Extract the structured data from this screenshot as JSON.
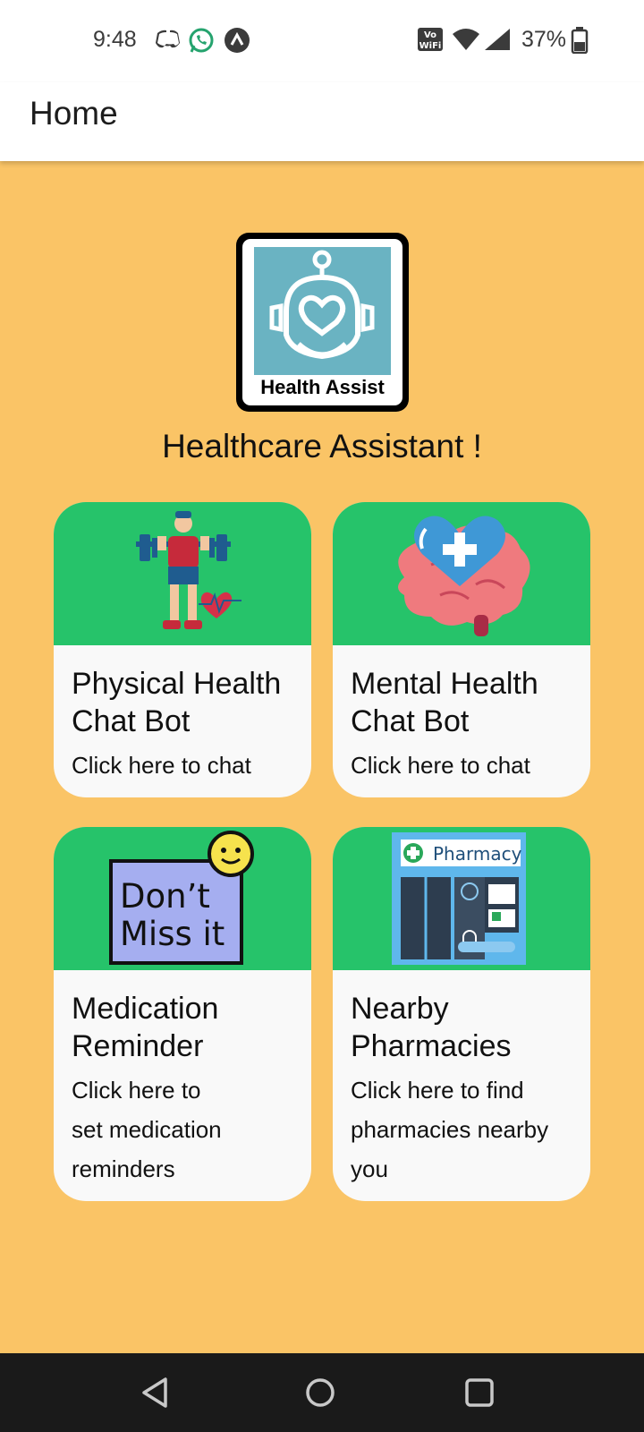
{
  "status_bar": {
    "time": "9:48",
    "battery": "37%",
    "icons": [
      "discord-icon",
      "whatsapp-icon",
      "arrow-up-circle-icon",
      "vowifi-icon",
      "wifi-icon",
      "signal-icon",
      "battery-icon"
    ]
  },
  "app_bar": {
    "title": "Home"
  },
  "logo": {
    "text": "Health Assist"
  },
  "headline": "Healthcare Assistant !",
  "cards": [
    {
      "title": "Physical Health\nChat Bot",
      "subtitle": "Click here to chat",
      "icon": "weightlifter-heart-icon"
    },
    {
      "title": "Mental Health\nChat Bot",
      "subtitle": "Click here to chat",
      "icon": "brain-heart-icon"
    },
    {
      "title": "Medication\nReminder",
      "subtitle": "Click here to\nset medication\nreminders",
      "icon": "dont-miss-it-icon",
      "icon_text": "Don't Miss it"
    },
    {
      "title": "Nearby\nPharmacies",
      "subtitle": "Click here to find\npharmacies nearby\nyou",
      "icon": "pharmacy-store-icon",
      "icon_text": "Pharmacy"
    }
  ],
  "nav_bar": {
    "buttons": [
      "back-icon",
      "home-icon",
      "recents-icon"
    ]
  },
  "colors": {
    "background": "#fac466",
    "card_header": "#26c36a",
    "card_body": "#f9f9f9"
  }
}
